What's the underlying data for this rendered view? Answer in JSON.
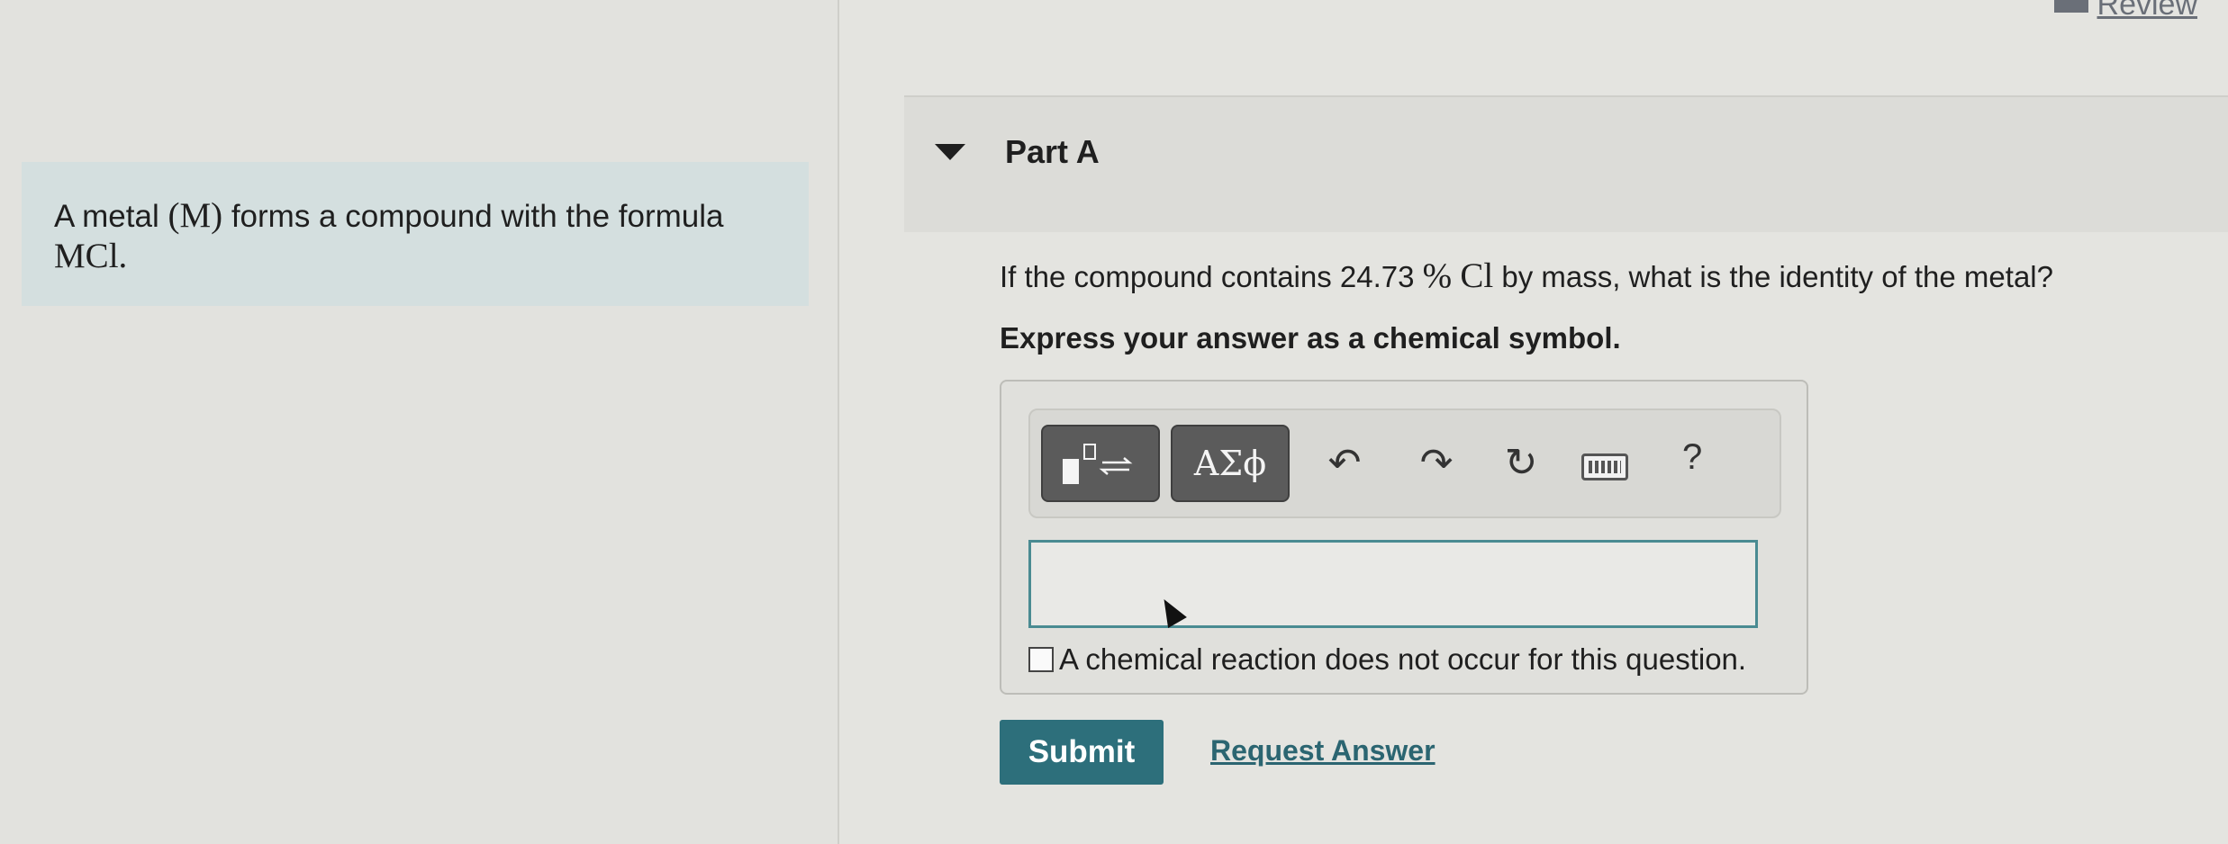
{
  "header": {
    "review_label": "Review"
  },
  "problem": {
    "text_before": "A metal ",
    "metal_symbol": "(M)",
    "text_after": " forms a compound with the formula",
    "formula": "MCl."
  },
  "part": {
    "title": "Part A",
    "question_before": "If the compound contains 24.73 ",
    "percent_symbol": "%",
    "element": "Cl",
    "question_after": " by mass, what is the identity of the metal?",
    "instruction": "Express your answer as a chemical symbol."
  },
  "toolbar": {
    "symbols_label": "ΑΣϕ",
    "undo_glyph": "↶",
    "redo_glyph": "↷",
    "reset_glyph": "↻",
    "help_label": "?"
  },
  "answer": {
    "value": ""
  },
  "no_reaction_label": "A chemical reaction does not occur for this question.",
  "actions": {
    "submit_label": "Submit",
    "request_answer_label": "Request Answer"
  },
  "colors": {
    "submit_bg": "#2d6f7b",
    "link": "#2b6571",
    "problem_bg": "#d4dfdf",
    "input_border": "#4a8b92"
  }
}
